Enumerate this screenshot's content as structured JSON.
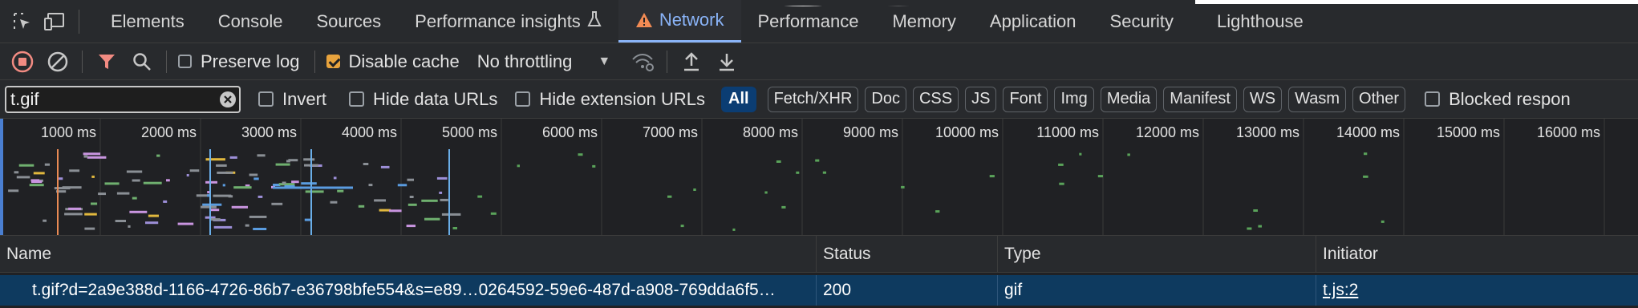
{
  "tabs": [
    {
      "label": "Elements"
    },
    {
      "label": "Console"
    },
    {
      "label": "Sources"
    },
    {
      "label": "Performance insights"
    },
    {
      "label": "Network",
      "active": true
    },
    {
      "label": "Performance"
    },
    {
      "label": "Memory"
    },
    {
      "label": "Application"
    },
    {
      "label": "Security"
    },
    {
      "label": "Lighthouse"
    }
  ],
  "toolbar": {
    "preserve_log": {
      "label": "Preserve log",
      "checked": false
    },
    "disable_cache": {
      "label": "Disable cache",
      "checked": true
    },
    "throttling": "No throttling"
  },
  "filter": {
    "value": "t.gif",
    "invert": {
      "label": "Invert",
      "checked": false
    },
    "hide_data_urls": {
      "label": "Hide data URLs",
      "checked": false
    },
    "hide_extension_urls": {
      "label": "Hide extension URLs",
      "checked": false
    },
    "types": [
      "All",
      "Fetch/XHR",
      "Doc",
      "CSS",
      "JS",
      "Font",
      "Img",
      "Media",
      "Manifest",
      "WS",
      "Wasm",
      "Other"
    ],
    "active_type": "All",
    "blocked_label": "Blocked respon"
  },
  "overview": {
    "ticks": [
      "1000 ms",
      "2000 ms",
      "3000 ms",
      "4000 ms",
      "5000 ms",
      "6000 ms",
      "7000 ms",
      "8000 ms",
      "9000 ms",
      "10000 ms",
      "11000 ms",
      "12000 ms",
      "13000 ms",
      "14000 ms",
      "15000 ms",
      "16000 ms"
    ]
  },
  "table": {
    "headers": {
      "name": "Name",
      "status": "Status",
      "type": "Type",
      "initiator": "Initiator"
    },
    "rows": [
      {
        "name": "t.gif?d=2a9e388d-1166-4726-86b7-e36798bfe554&s=e89…0264592-59e6-487d-a908-769dda6f5…",
        "status": "200",
        "type": "gif",
        "initiator": "t.js:2"
      }
    ]
  },
  "colors": {
    "accent": "#8ab4f8",
    "warning": "#f28b54",
    "record_stop": "#f28b82",
    "filter_red": "#f28b82",
    "selected_row": "#0e3a5f",
    "active_pill": "#0b3d73"
  }
}
